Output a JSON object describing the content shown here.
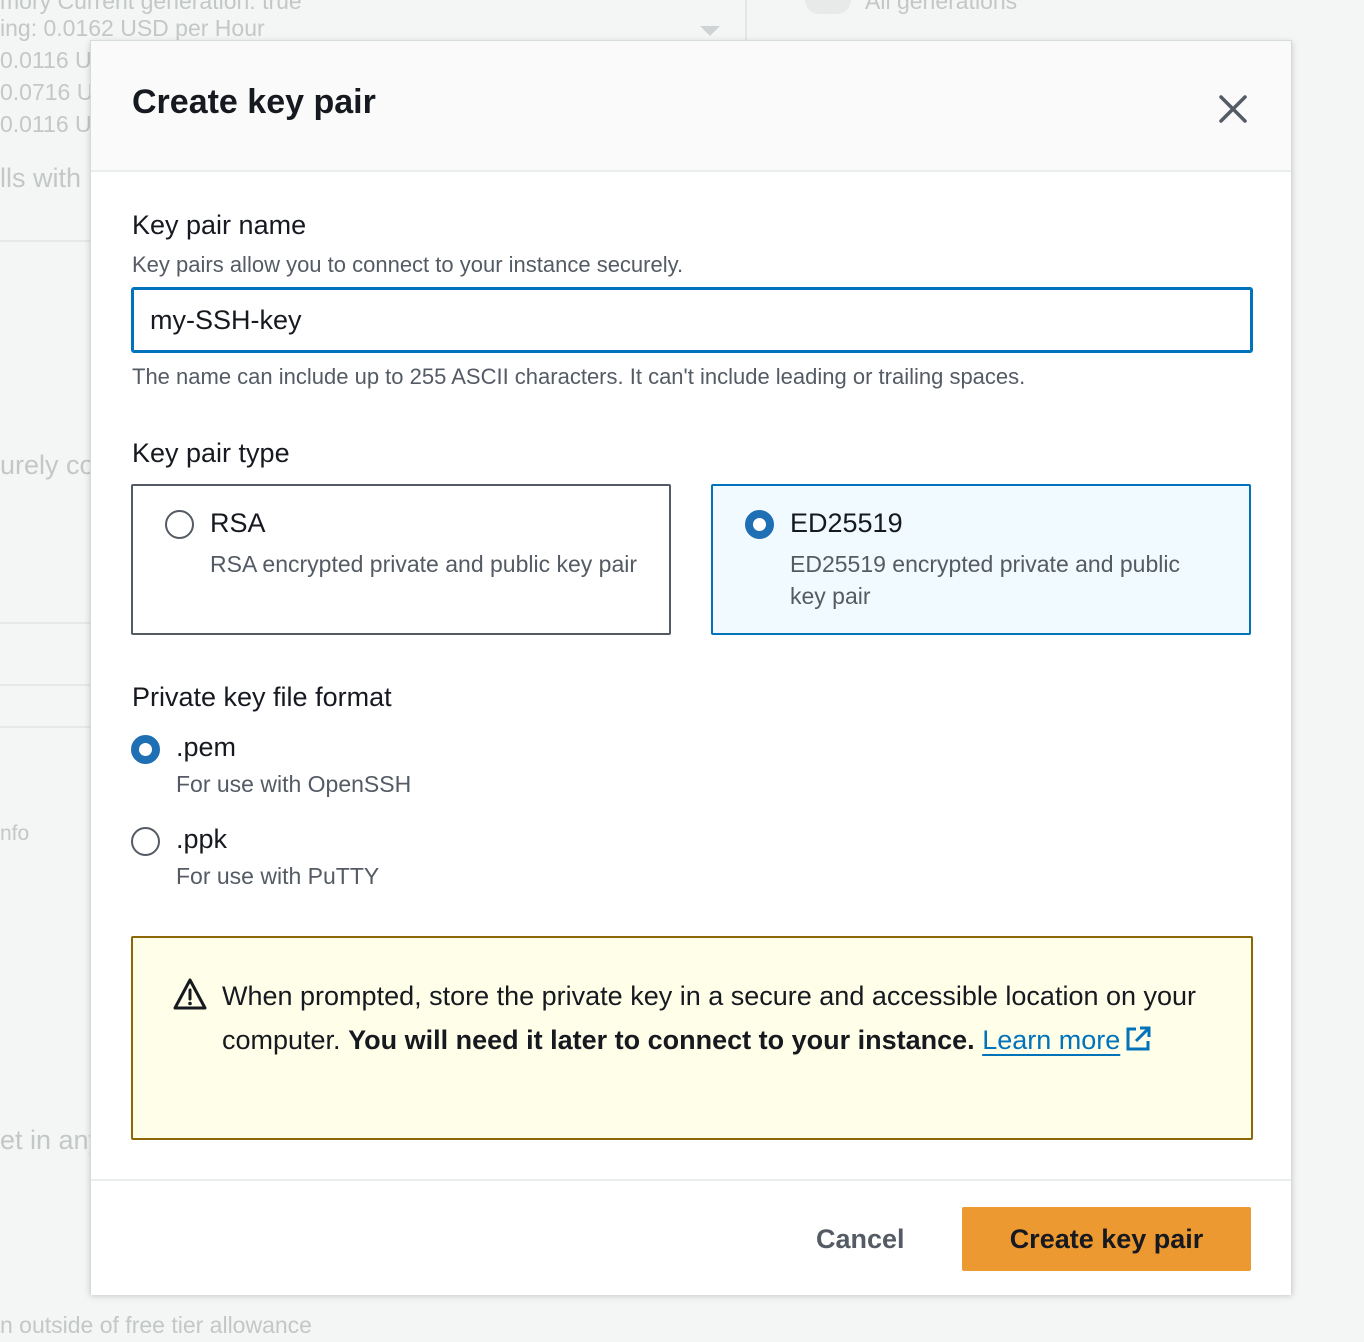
{
  "background": {
    "lines": [
      "mory    Current generation: true",
      "ing: 0.0162 USD per Hour",
      "0.0116 U",
      "0.0716 U",
      "0.0116 U",
      "lls with",
      "urely co",
      "nfo",
      "et in any",
      "n outside of free tier allowance",
      "All generations"
    ]
  },
  "modal": {
    "title": "Create key pair",
    "close_icon": "close-icon",
    "name": {
      "label": "Key pair name",
      "description": "Key pairs allow you to connect to your instance securely.",
      "value": "my-SSH-key",
      "constraint": "The name can include up to 255 ASCII characters. It can't include leading or trailing spaces."
    },
    "type": {
      "label": "Key pair type",
      "options": [
        {
          "title": "RSA",
          "description": "RSA encrypted private and public key pair",
          "selected": false
        },
        {
          "title": "ED25519",
          "description": "ED25519 encrypted private and public key pair",
          "selected": true
        }
      ]
    },
    "format": {
      "label": "Private key file format",
      "options": [
        {
          "title": ".pem",
          "description": "For use with OpenSSH",
          "selected": true
        },
        {
          "title": ".ppk",
          "description": "For use with PuTTY",
          "selected": false
        }
      ]
    },
    "alert": {
      "icon": "warning-icon",
      "text": "When prompted, store the private key in a secure and accessible location on your computer.",
      "bold_text": "You will need it later to connect to your instance.",
      "link_text": "Learn more",
      "link_icon": "external-link-icon"
    },
    "footer": {
      "cancel_label": "Cancel",
      "create_label": "Create key pair"
    }
  },
  "colors": {
    "accent": "#0073bb",
    "primary_button": "#ec9932",
    "warning_border": "#8d6605",
    "warning_bg": "#fffee8"
  }
}
